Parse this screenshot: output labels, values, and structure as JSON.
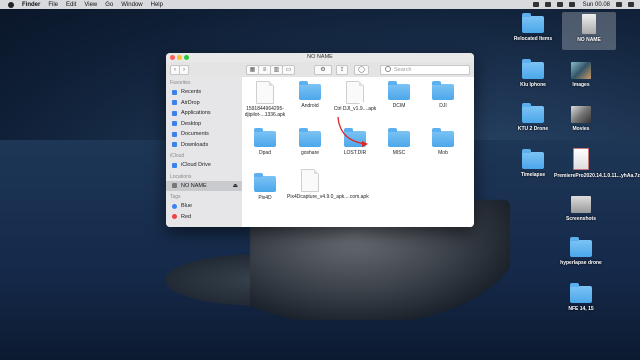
{
  "menubar": {
    "app": "Finder",
    "items": [
      "File",
      "Edit",
      "View",
      "Go",
      "Window",
      "Help"
    ],
    "clock": "Sun 00.08"
  },
  "window": {
    "title": "NO NAME",
    "search_placeholder": "Search"
  },
  "sidebar": {
    "favorites_head": "Favorites",
    "favorites": [
      "Recents",
      "AirDrop",
      "Applications",
      "Desktop",
      "Documents",
      "Downloads"
    ],
    "icloud_head": "iCloud",
    "icloud": [
      "iCloud Drive"
    ],
    "locations_head": "Locations",
    "locations": [
      "NO NAME"
    ],
    "tags_head": "Tags",
    "tags": [
      {
        "label": "Blue",
        "color": "#3b82f6"
      },
      {
        "label": "Red",
        "color": "#ef4444"
      }
    ]
  },
  "files": [
    {
      "label": "1591844964295-djipilot-...1336.apk",
      "kind": "doc"
    },
    {
      "label": "Android",
      "kind": "folder"
    },
    {
      "label": "Ctrl DJI_v1.9....apk",
      "kind": "doc"
    },
    {
      "label": "DCIM",
      "kind": "folder"
    },
    {
      "label": "DJI",
      "kind": "folder"
    },
    {
      "label": "Dpad",
      "kind": "folder"
    },
    {
      "label": "goshare",
      "kind": "folder"
    },
    {
      "label": "LOST.DIR",
      "kind": "folder"
    },
    {
      "label": "MISC",
      "kind": "folder"
    },
    {
      "label": "Mob",
      "kind": "folder"
    },
    {
      "label": "Pix4D",
      "kind": "folder"
    },
    {
      "label": "Pix4Dcapture_v4.9.0_apk....com.apk",
      "kind": "doc"
    }
  ],
  "desktop": [
    {
      "label": "Relocated Items",
      "kind": "folder"
    },
    {
      "label": "NO NAME",
      "kind": "drive"
    },
    {
      "label": "Klu Iphone",
      "kind": "folder"
    },
    {
      "label": "Images",
      "kind": "image"
    },
    {
      "label": "KTU 2 Drone",
      "kind": "folder"
    },
    {
      "label": "Movies",
      "kind": "image"
    },
    {
      "label": "Timelapse",
      "kind": "folder"
    },
    {
      "label": "PremierePro2020.14.1.0.11...yhAa.7z",
      "kind": "archive"
    },
    {
      "label": "Screenshots",
      "kind": "image"
    },
    {
      "label": "hyperlapse drone",
      "kind": "folder"
    },
    {
      "label": "NFE 14, 15",
      "kind": "folder"
    }
  ],
  "colors": {
    "folder": "#5cb0ef",
    "accent": "#3b83e8",
    "arrow": "#e02424"
  }
}
